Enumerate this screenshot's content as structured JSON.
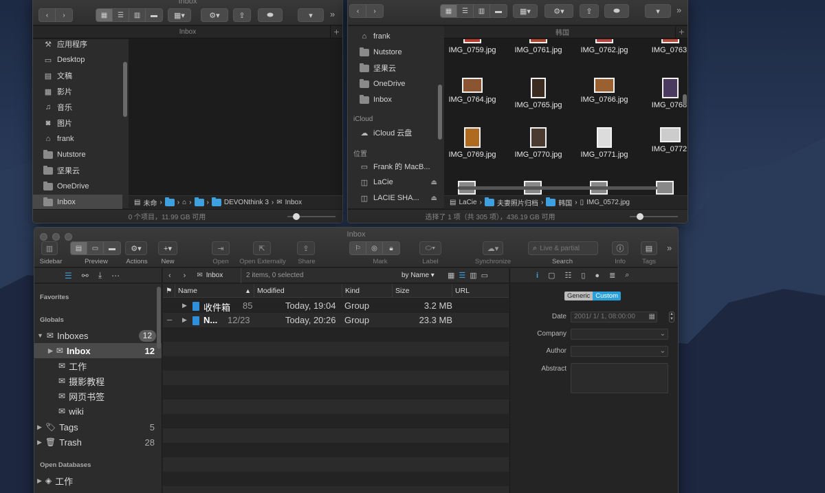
{
  "finder_left": {
    "title": "Inbox",
    "tab": "Inbox",
    "sidebar": [
      {
        "label": "应用程序",
        "icon": "applications-icon"
      },
      {
        "label": "Desktop",
        "icon": "desktop-icon"
      },
      {
        "label": "文稿",
        "icon": "documents-icon"
      },
      {
        "label": "影片",
        "icon": "movies-icon"
      },
      {
        "label": "音乐",
        "icon": "music-icon"
      },
      {
        "label": "图片",
        "icon": "pictures-icon"
      },
      {
        "label": "frank",
        "icon": "home-icon"
      },
      {
        "label": "Nutstore",
        "icon": "folder-icon"
      },
      {
        "label": "坚果云",
        "icon": "folder-icon"
      },
      {
        "label": "OneDrive",
        "icon": "folder-icon"
      },
      {
        "label": "Inbox",
        "icon": "folder-icon"
      }
    ],
    "path": [
      "未命",
      "",
      "",
      "",
      "DEVONthink 3",
      "Inbox"
    ],
    "status": "0 个项目，11.99 GB 可用"
  },
  "finder_right": {
    "tab": "韩国",
    "sidebar_top": [
      {
        "label": "frank"
      },
      {
        "label": "Nutstore"
      },
      {
        "label": "坚果云"
      },
      {
        "label": "OneDrive"
      },
      {
        "label": "Inbox"
      }
    ],
    "icloud_header": "iCloud",
    "icloud_item": "iCloud 云盘",
    "locations_header": "位置",
    "locations": [
      {
        "label": "Frank 的 MacB..."
      },
      {
        "label": "LaCie"
      },
      {
        "label": "LACIE SHA..."
      }
    ],
    "files": [
      [
        "IMG_0759.jpg",
        "IMG_0761.jpg",
        "IMG_0762.jpg",
        "IMG_0763."
      ],
      [
        "IMG_0764.jpg",
        "IMG_0765.jpg",
        "IMG_0766.jpg",
        "IMG_0768."
      ],
      [
        "IMG_0769.jpg",
        "IMG_0770.jpg",
        "IMG_0771.jpg",
        "IMG_0772."
      ]
    ],
    "path": [
      "LaCie",
      "夫妻照片归档",
      "韩国",
      "IMG_0572.jpg"
    ],
    "status": "选择了 1 项（共 305 项），436.19 GB 可用"
  },
  "devonthink": {
    "title": "Inbox",
    "toolbar": {
      "sidebar": "Sidebar",
      "preview": "Preview",
      "actions": "Actions",
      "new": "New",
      "open": "Open",
      "open_externally": "Open Externally",
      "share": "Share",
      "mark": "Mark",
      "label": "Label",
      "synchronize": "Synchronize",
      "search": "Search",
      "search_placeholder": "Live & partial",
      "info": "Info",
      "tags": "Tags"
    },
    "nav": {
      "location": "Inbox",
      "count": "2 items, 0 selected",
      "sort": "by Name"
    },
    "sidebar": {
      "favorites": "Favorites",
      "globals": "Globals",
      "inboxes": {
        "label": "Inboxes",
        "badge": "12"
      },
      "inbox": {
        "label": "Inbox",
        "count": "12"
      },
      "children": [
        "工作",
        "摄影教程",
        "网页书签",
        "wiki"
      ],
      "tags": {
        "label": "Tags",
        "count": "5"
      },
      "trash": {
        "label": "Trash",
        "count": "28"
      },
      "open_databases": "Open Databases",
      "db": "工作"
    },
    "columns": {
      "name": "Name",
      "modified": "Modified",
      "kind": "Kind",
      "size": "Size",
      "url": "URL"
    },
    "rows": [
      {
        "name": "收件箱",
        "count": "85",
        "modified": "Today, 19:04",
        "kind": "Group",
        "size": "3.2 MB"
      },
      {
        "name": "N...",
        "count": "12/23",
        "modified": "Today, 20:26",
        "kind": "Group",
        "size": "23.3 MB"
      }
    ],
    "inspector": {
      "generic": "Generic",
      "custom": "Custom",
      "date_label": "Date",
      "date_value": "2001/ 1/ 1, 08:00:00",
      "company": "Company",
      "author": "Author",
      "abstract": "Abstract"
    }
  }
}
